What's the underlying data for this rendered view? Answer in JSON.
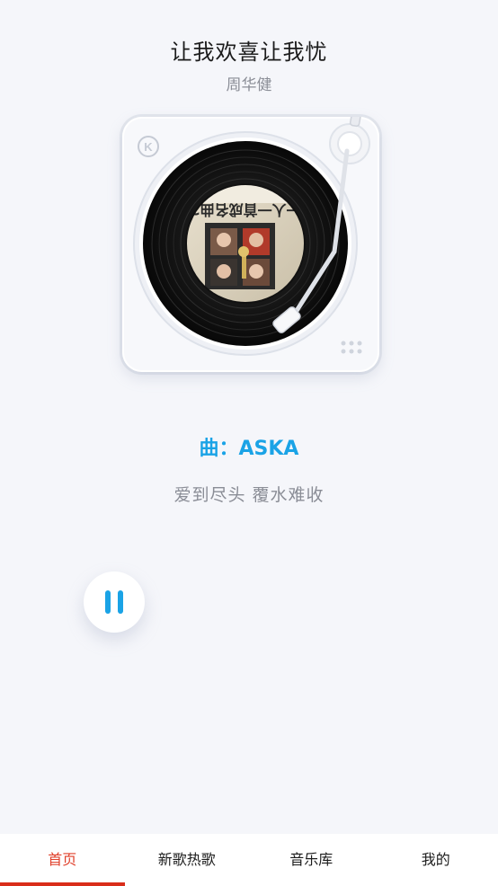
{
  "song": {
    "title": "让我欢喜让我忧",
    "artist": "周华健",
    "composer_line": "曲：ASKA",
    "current_lyric": "爱到尽头 覆水难收"
  },
  "turntable": {
    "logo_letter": "K",
    "album_cover_text": "一人一首成名曲2"
  },
  "player": {
    "state": "playing",
    "control_icon": "pause-icon"
  },
  "tabs": [
    {
      "label": "首页",
      "active": true
    },
    {
      "label": "新歌热歌",
      "active": false
    },
    {
      "label": "音乐库",
      "active": false
    },
    {
      "label": "我的",
      "active": false
    }
  ],
  "colors": {
    "accent": "#1aa3e6",
    "active_tab": "#e0402b",
    "indicator": "#d92d1a",
    "background": "#f5f6fa"
  }
}
